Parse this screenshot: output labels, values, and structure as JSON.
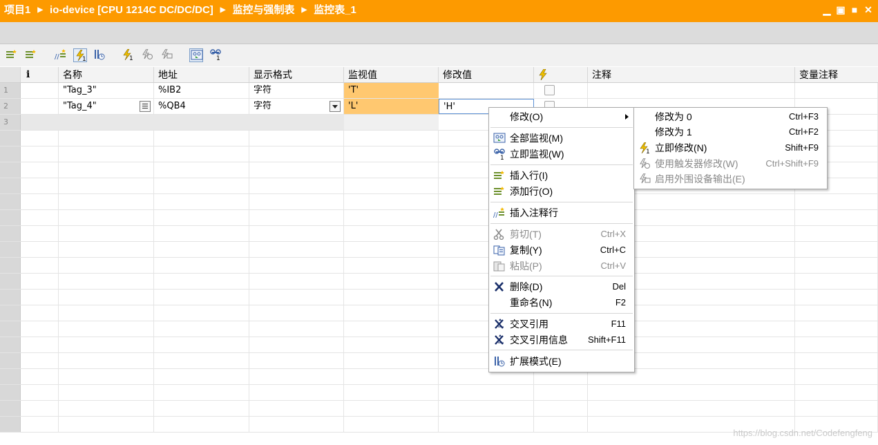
{
  "title_bar": {
    "crumbs": [
      "项目1",
      "io-device [CPU 1214C DC/DC/DC]",
      "监控与强制表",
      "监控表_1"
    ],
    "window_buttons": [
      "minimize-icon",
      "restore-icon",
      "maximize-icon",
      "close-icon"
    ]
  },
  "toolbar": {
    "buttons": [
      "insert-row-icon",
      "add-row-icon",
      "insert-comment-row-icon",
      "monitor-all-icon",
      "extended-mode-icon",
      "modify-now-icon",
      "modify-trigger-icon",
      "enable-periphery-icon",
      "monitor-all-icon",
      "monitor-now-icon"
    ]
  },
  "table": {
    "columns": [
      "",
      "i",
      "名称",
      "地址",
      "显示格式",
      "监视值",
      "修改值",
      "",
      "注释",
      "变量注释"
    ],
    "rows": [
      {
        "num": "1",
        "name": "\"Tag_3\"",
        "address": "%IB2",
        "format": "字符",
        "monitor": "'T'",
        "modify": ""
      },
      {
        "num": "2",
        "name": "\"Tag_4\"",
        "address": "%QB4",
        "format": "字符",
        "monitor": "'L'",
        "modify": "'H'"
      },
      {
        "num": "3",
        "name": "",
        "address": "",
        "format": "",
        "monitor": "",
        "modify": ""
      }
    ]
  },
  "context_menu": {
    "items": [
      {
        "label": "修改(O)",
        "shortcut": "",
        "icon": "",
        "submenu": true,
        "enabled": true
      },
      {
        "label": "全部监视(M)",
        "shortcut": "",
        "icon": "monitor-all-icon",
        "enabled": true
      },
      {
        "label": "立即监视(W)",
        "shortcut": "",
        "icon": "monitor-now-icon",
        "enabled": true
      },
      {
        "label": "插入行(I)",
        "shortcut": "",
        "icon": "insert-row-icon",
        "enabled": true
      },
      {
        "label": "添加行(O)",
        "shortcut": "",
        "icon": "add-row-icon",
        "enabled": true
      },
      {
        "label": "插入注释行",
        "shortcut": "",
        "icon": "insert-comment-row-icon",
        "enabled": true
      },
      {
        "label": "剪切(T)",
        "shortcut": "Ctrl+X",
        "icon": "cut-icon",
        "enabled": false
      },
      {
        "label": "复制(Y)",
        "shortcut": "Ctrl+C",
        "icon": "copy-icon",
        "enabled": true
      },
      {
        "label": "粘贴(P)",
        "shortcut": "Ctrl+V",
        "icon": "paste-icon",
        "enabled": false
      },
      {
        "label": "删除(D)",
        "shortcut": "Del",
        "icon": "delete-icon",
        "enabled": true
      },
      {
        "label": "重命名(N)",
        "shortcut": "F2",
        "icon": "",
        "enabled": true
      },
      {
        "label": "交叉引用",
        "shortcut": "F11",
        "icon": "cross-reference-icon",
        "enabled": true
      },
      {
        "label": "交叉引用信息",
        "shortcut": "Shift+F11",
        "icon": "cross-reference-icon",
        "enabled": true
      },
      {
        "label": "扩展模式(E)",
        "shortcut": "",
        "icon": "extended-mode-icon",
        "enabled": true
      }
    ]
  },
  "submenu": {
    "items": [
      {
        "label": "修改为 0",
        "shortcut": "Ctrl+F3",
        "icon": "",
        "enabled": true
      },
      {
        "label": "修改为 1",
        "shortcut": "Ctrl+F2",
        "icon": "",
        "enabled": true
      },
      {
        "label": "立即修改(N)",
        "shortcut": "Shift+F9",
        "icon": "modify-now-icon",
        "enabled": true
      },
      {
        "label": "使用触发器修改(W)",
        "shortcut": "Ctrl+Shift+F9",
        "icon": "modify-trigger-icon",
        "enabled": false
      },
      {
        "label": "启用外围设备输出(E)",
        "shortcut": "",
        "icon": "enable-periphery-icon",
        "enabled": false
      }
    ]
  },
  "watermark": "https://blog.csdn.net/Codefengfeng",
  "colors": {
    "title_bar": "#fd9a00",
    "monitor_cell": "#ffc870",
    "selection_border": "#5a8fd4"
  }
}
